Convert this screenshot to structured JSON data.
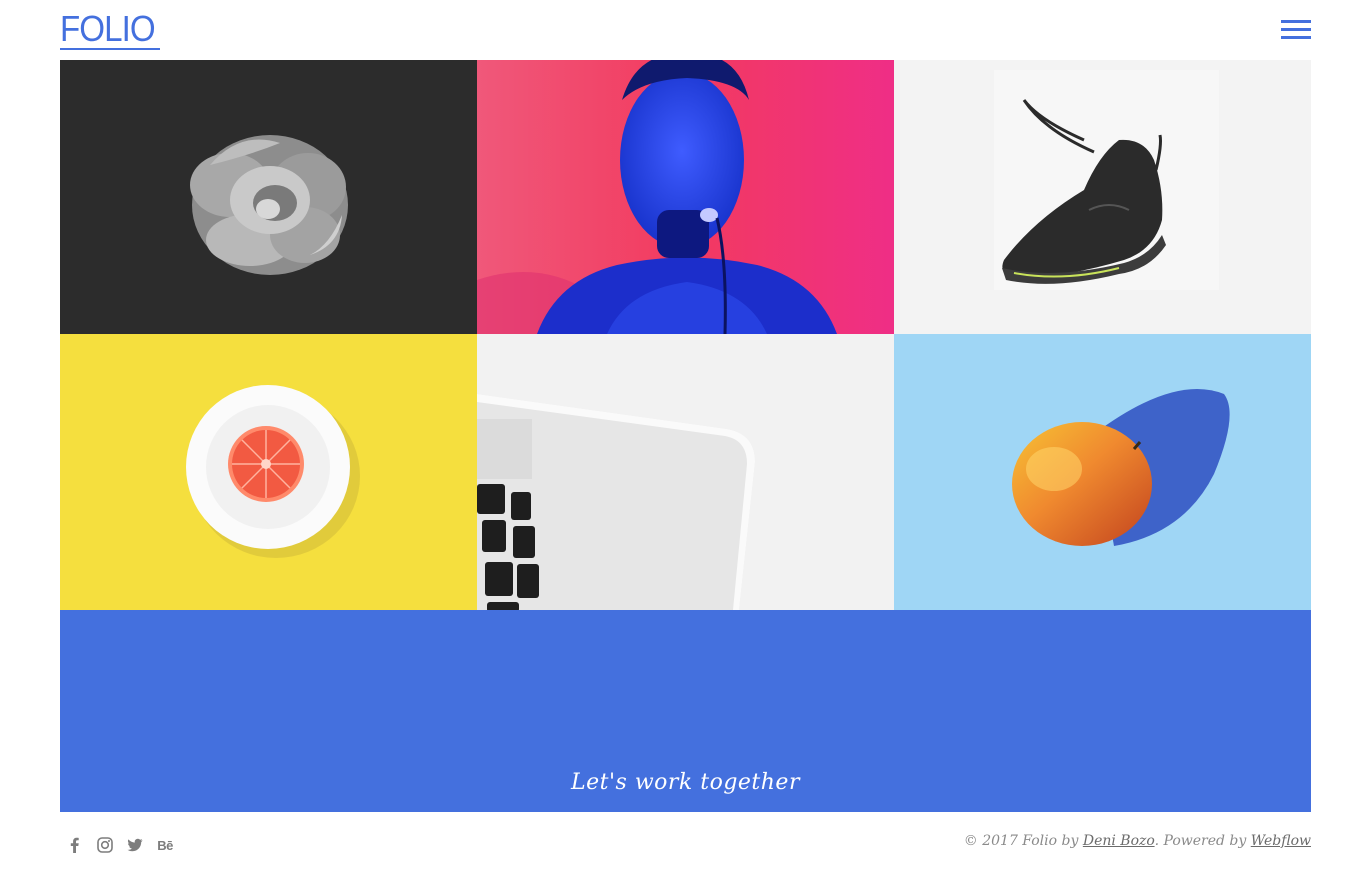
{
  "header": {
    "logo_text": "FOLIO",
    "menu_icon": "hamburger-menu-icon",
    "accent_color": "#4470de"
  },
  "gallery": {
    "tiles": [
      {
        "subject": "rose",
        "background": "#2b2b2b"
      },
      {
        "subject": "man-with-microphone",
        "background": "#f03a63"
      },
      {
        "subject": "sneaker",
        "background": "#f2f2f2"
      },
      {
        "subject": "grapefruit-on-plate",
        "background": "#f5df3e"
      },
      {
        "subject": "laptop-keyboard",
        "background": "#f0f0f0"
      },
      {
        "subject": "mango",
        "background": "#9fd6f5"
      }
    ]
  },
  "cta": {
    "text": "Let's work together",
    "background": "#4470de"
  },
  "footer": {
    "social_icons": [
      "facebook-icon",
      "instagram-icon",
      "twitter-icon",
      "behance-icon"
    ],
    "behance_text": "Bē",
    "credits_prefix": "© 2017 Folio by",
    "author_link": "Deni Bozo",
    "powered_text": ". Powered by",
    "platform_link": "Webflow"
  }
}
